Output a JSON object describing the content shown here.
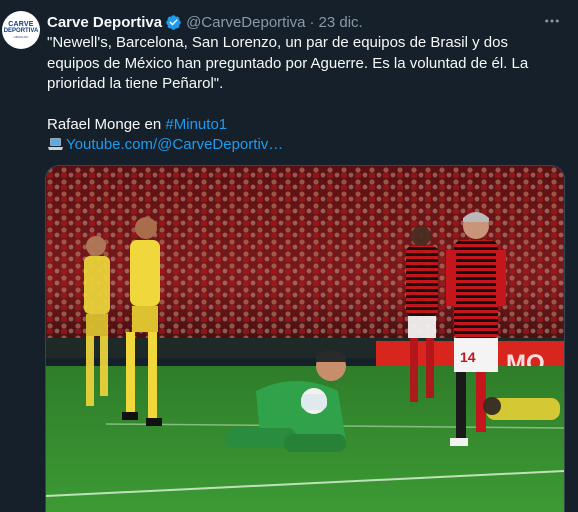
{
  "author": {
    "name": "Carve Deportiva",
    "handle": "@CarveDeportiva",
    "separator": "·",
    "date": "23 dic.",
    "avatar_text": [
      "CARVE",
      "DEPORTIVA",
      "URUGUAY"
    ]
  },
  "tweet": {
    "quote": "\"Newell's, Barcelona, San Lorenzo, un par de equipos de Brasil y dos equipos de México han preguntado por Aguerre. Es la voluntad de él. La prioridad la tiene Peñarol\".",
    "credit_text": "Rafael Monge en ",
    "hashtag": "#Minuto1",
    "link": "Youtube.com/@CarveDeportiv…"
  },
  "media": {
    "alt": "Foto del partido: arquero de amarillo y negro atajando el balón y jugador de rojo y negro",
    "shirt_number": "14"
  },
  "icons": {
    "verified": "verified-badge-icon",
    "more": "more-options-icon",
    "laptop": "laptop-emoji-icon"
  },
  "colors": {
    "background": "#15202b",
    "text": "#f7f9f9",
    "secondary": "#8b98a5",
    "link": "#1d9bf0"
  }
}
